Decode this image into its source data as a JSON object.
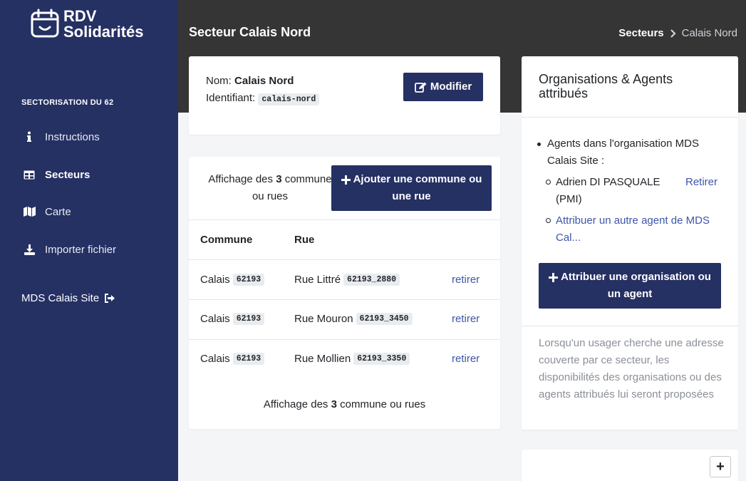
{
  "sidebar": {
    "logo_line1": "RDV",
    "logo_line2": "Solidarités",
    "section_label": "SECTORISATION DU 62",
    "items": [
      {
        "label": "Instructions",
        "icon": "info-icon"
      },
      {
        "label": "Secteurs",
        "icon": "table-icon"
      },
      {
        "label": "Carte",
        "icon": "map-icon"
      },
      {
        "label": "Importer fichier",
        "icon": "download-icon"
      }
    ],
    "org_link": "MDS Calais Site",
    "org_icon": "sign-out-icon"
  },
  "header": {
    "title": "Secteur Calais Nord",
    "breadcrumb_link": "Secteurs",
    "breadcrumb_current": "Calais Nord"
  },
  "info": {
    "name_label": "Nom:",
    "name_value": "Calais Nord",
    "id_label": "Identifiant:",
    "id_value": "calais-nord",
    "edit_button": "Modifier"
  },
  "communes": {
    "count_prefix": "Affichage des",
    "count_value": "3",
    "count_suffix_top": "commune",
    "count_suffix_bottom": "ou rues",
    "count_suffix_full": "commune ou rues",
    "add_button_line1": "Ajouter une commune ou",
    "add_button_line2": "une rue",
    "columns": [
      "Commune",
      "Rue"
    ],
    "rows": [
      {
        "commune": "Calais",
        "commune_code": "62193",
        "rue": "Rue Littré",
        "rue_code": "62193_2880",
        "action": "retirer"
      },
      {
        "commune": "Calais",
        "commune_code": "62193",
        "rue": "Rue Mouron",
        "rue_code": "62193_3450",
        "action": "retirer"
      },
      {
        "commune": "Calais",
        "commune_code": "62193",
        "rue": "Rue Mollien",
        "rue_code": "62193_3350",
        "action": "retirer"
      }
    ]
  },
  "orgs": {
    "title_line1": "Organisations & Agents",
    "title_line2": "attribués",
    "agents_heading_line1": "Agents dans l'organisation MDS",
    "agents_heading_line2": "Calais Site :",
    "agent_name_line1": "Adrien DI PASQUALE",
    "agent_name_line2": "(PMI)",
    "agent_remove": "Retirer",
    "assign_agent_line1": "Attribuer un autre agent de MDS",
    "assign_agent_line2": "Cal...",
    "assign_button_line1": "Attribuer une organisation ou",
    "assign_button_line2": "un agent",
    "help_text": "Lorsqu'un usager cherche une adresse couverte par ce secteur, les disponibilités des organisations ou des agents attribués lui seront proposées"
  },
  "map": {
    "zoom_in": "+"
  },
  "colors": {
    "sidebar_bg": "#253063",
    "header_bg": "#353535",
    "primary": "#253063",
    "link": "#3d55a8"
  }
}
